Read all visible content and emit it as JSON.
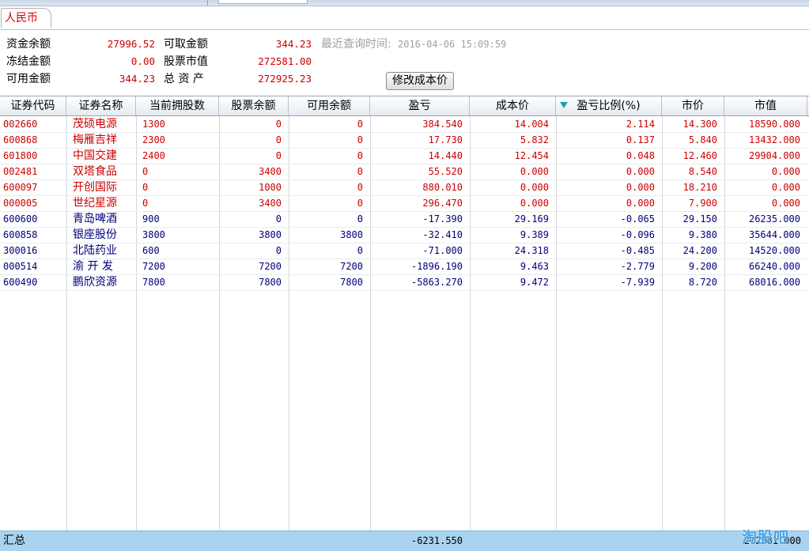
{
  "tab": {
    "label": "人民币"
  },
  "summary": {
    "left": [
      {
        "label": "资金余额",
        "value": "27996.52"
      },
      {
        "label": "冻结金额",
        "value": "0.00"
      },
      {
        "label": "可用金额",
        "value": "344.23"
      }
    ],
    "mid": [
      {
        "label": "可取金额",
        "value": "344.23"
      },
      {
        "label": "股票市值",
        "value": "272581.00"
      },
      {
        "label": "总 资 产",
        "value": "272925.23"
      }
    ],
    "query_label": "最近查询时间:",
    "query_time": "2016-04-06 15:09:59",
    "modify_button": "修改成本价"
  },
  "table": {
    "columns": [
      "证券代码",
      "证券名称",
      "当前拥股数",
      "股票余额",
      "可用余额",
      "盈亏",
      "成本价",
      "盈亏比例(%)",
      "市价",
      "市值"
    ],
    "sorted_column_index": 7,
    "sort_icon": "sort-descending-icon",
    "colors": {
      "profit": "#cc0000",
      "loss": "#00007a"
    },
    "rows": [
      {
        "code": "002660",
        "name": "茂硕电源",
        "held": "1300",
        "balance": "0",
        "avail": "0",
        "pl": "384.540",
        "cost": "14.004",
        "ratio": "2.114",
        "price": "14.300",
        "value": "18590.000",
        "type": "profit"
      },
      {
        "code": "600868",
        "name": "梅雁吉祥",
        "held": "2300",
        "balance": "0",
        "avail": "0",
        "pl": "17.730",
        "cost": "5.832",
        "ratio": "0.137",
        "price": "5.840",
        "value": "13432.000",
        "type": "profit"
      },
      {
        "code": "601800",
        "name": "中国交建",
        "held": "2400",
        "balance": "0",
        "avail": "0",
        "pl": "14.440",
        "cost": "12.454",
        "ratio": "0.048",
        "price": "12.460",
        "value": "29904.000",
        "type": "profit"
      },
      {
        "code": "002481",
        "name": "双塔食品",
        "held": "0",
        "balance": "3400",
        "avail": "0",
        "pl": "55.520",
        "cost": "0.000",
        "ratio": "0.000",
        "price": "8.540",
        "value": "0.000",
        "type": "profit"
      },
      {
        "code": "600097",
        "name": "开创国际",
        "held": "0",
        "balance": "1000",
        "avail": "0",
        "pl": "880.010",
        "cost": "0.000",
        "ratio": "0.000",
        "price": "18.210",
        "value": "0.000",
        "type": "profit"
      },
      {
        "code": "000005",
        "name": "世纪星源",
        "held": "0",
        "balance": "3400",
        "avail": "0",
        "pl": "296.470",
        "cost": "0.000",
        "ratio": "0.000",
        "price": "7.900",
        "value": "0.000",
        "type": "profit"
      },
      {
        "code": "600600",
        "name": "青岛啤酒",
        "held": "900",
        "balance": "0",
        "avail": "0",
        "pl": "-17.390",
        "cost": "29.169",
        "ratio": "-0.065",
        "price": "29.150",
        "value": "26235.000",
        "type": "loss"
      },
      {
        "code": "600858",
        "name": "银座股份",
        "held": "3800",
        "balance": "3800",
        "avail": "3800",
        "pl": "-32.410",
        "cost": "9.389",
        "ratio": "-0.096",
        "price": "9.380",
        "value": "35644.000",
        "type": "loss"
      },
      {
        "code": "300016",
        "name": "北陆药业",
        "held": "600",
        "balance": "0",
        "avail": "0",
        "pl": "-71.000",
        "cost": "24.318",
        "ratio": "-0.485",
        "price": "24.200",
        "value": "14520.000",
        "type": "loss"
      },
      {
        "code": "000514",
        "name": "渝 开 发",
        "held": "7200",
        "balance": "7200",
        "avail": "7200",
        "pl": "-1896.190",
        "cost": "9.463",
        "ratio": "-2.779",
        "price": "9.200",
        "value": "66240.000",
        "type": "loss"
      },
      {
        "code": "600490",
        "name": "鹏欣资源",
        "held": "7800",
        "balance": "7800",
        "avail": "7800",
        "pl": "-5863.270",
        "cost": "9.472",
        "ratio": "-7.939",
        "price": "8.720",
        "value": "68016.000",
        "type": "loss"
      }
    ]
  },
  "totals": {
    "label": "汇总",
    "pl": "-6231.550",
    "value": "272581.000"
  },
  "watermark": "淘股吧"
}
